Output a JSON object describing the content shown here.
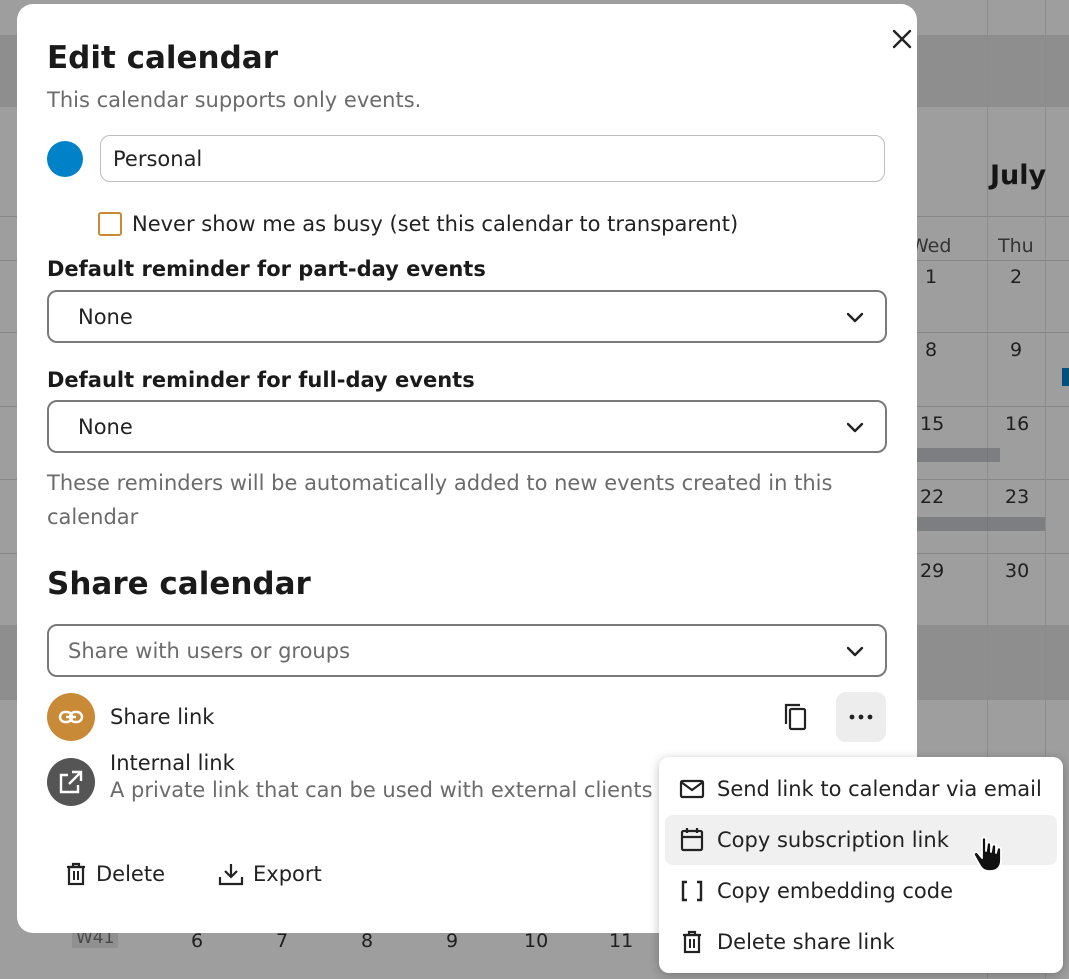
{
  "background_calendar": {
    "month": "July",
    "day_names": [
      "Wed",
      "Thu"
    ],
    "rows": [
      [
        "1",
        "2"
      ],
      [
        "8",
        "9"
      ],
      [
        "15",
        "16"
      ],
      [
        "22",
        "23"
      ],
      [
        "29",
        "30"
      ]
    ],
    "week_label": "W41",
    "week_days": [
      "6",
      "7",
      "8",
      "9",
      "10",
      "11"
    ]
  },
  "modal": {
    "title": "Edit calendar",
    "subtitle": "This calendar supports only events.",
    "calendar_color": "#0082c9",
    "calendar_name": "Personal",
    "transparent_label": "Never show me as busy (set this calendar to transparent)",
    "transparent_checked": false,
    "part_day_label": "Default reminder for part-day events",
    "part_day_value": "None",
    "full_day_label": "Default reminder for full-day events",
    "full_day_value": "None",
    "reminder_hint": "These reminders will be automatically added to new events created in this calendar",
    "share_title": "Share calendar",
    "share_placeholder": "Share with users or groups",
    "share_link_label": "Share link",
    "share_link_color": "#c98a37",
    "internal_link_title": "Internal link",
    "internal_link_subtitle": "A private link that can be used with external clients",
    "delete_label": "Delete",
    "export_label": "Export"
  },
  "share_menu": {
    "items": [
      {
        "label": "Send link to calendar via email",
        "icon": "email-icon"
      },
      {
        "label": "Copy subscription link",
        "icon": "calendar-icon"
      },
      {
        "label": "Copy embedding code",
        "icon": "brackets-icon"
      },
      {
        "label": "Delete share link",
        "icon": "trash-icon"
      }
    ],
    "hovered_item": "Copy subscription link"
  }
}
